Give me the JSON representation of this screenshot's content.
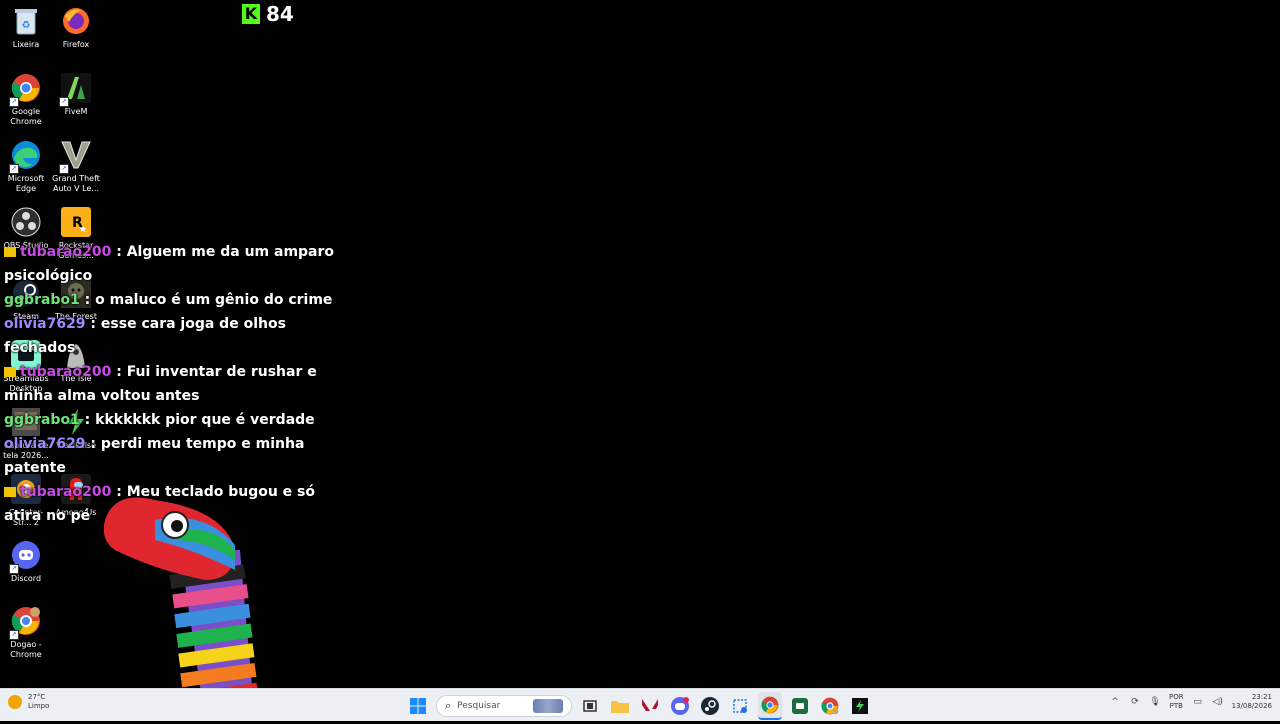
{
  "desktop": {
    "icons": [
      {
        "label": "Lixeira"
      },
      {
        "label": "Firefox"
      },
      {
        "label": "Google Chrome"
      },
      {
        "label": "FiveM"
      },
      {
        "label": "Microsoft Edge"
      },
      {
        "label": "Grand Theft Auto V Le..."
      },
      {
        "label": "OBS Studio"
      },
      {
        "label": "Rockstar Games..."
      },
      {
        "label": "Steam"
      },
      {
        "label": "The Forest"
      },
      {
        "label": "Streamlabs Desktop"
      },
      {
        "label": "The Isle"
      },
      {
        "label": "Captura de tela 2026..."
      },
      {
        "label": "ViewPulse"
      },
      {
        "label": "Counter-Str... 2"
      },
      {
        "label": "Among Us"
      },
      {
        "label": "Discord"
      },
      {
        "label": "Dogao - Chrome"
      }
    ]
  },
  "kick": {
    "count": "84",
    "logo": "K"
  },
  "chat": {
    "messages": [
      {
        "user": "tubarao200",
        "sep": " : ",
        "text": "Alguem me da um amparo psicológico"
      },
      {
        "user": "ggbrabo1",
        "sep": " : ",
        "text": "o maluco é um gênio do crime"
      },
      {
        "user": "olivia7629",
        "sep": " : ",
        "text": "esse cara joga de olhos fechados"
      },
      {
        "user": "tubarao200",
        "sep": " : ",
        "text": "Fui inventar de rushar e minha alma voltou antes"
      },
      {
        "user": "ggbrabo1",
        "sep": " : ",
        "text": "kkkkkkk pior que é verdade"
      },
      {
        "user": "olivia7629",
        "sep": " : ",
        "text": "perdi meu tempo e minha patente"
      },
      {
        "user": "tubarao200",
        "sep": " : ",
        "text": "Meu teclado bugou e só atira no pé"
      }
    ]
  },
  "taskbar": {
    "weather_temp": "27°C",
    "weather_desc": "Limpo",
    "search_placeholder": "Pesquisar",
    "lang_top": "POR",
    "lang_bottom": "PTB",
    "time": "23:21",
    "date": "13/08/2026"
  },
  "colors": {
    "kick_green": "#53fc18",
    "user_tubarao": "#c64ce2",
    "user_ggbrabo": "#6fe27a",
    "user_olivia": "#9a8cff"
  }
}
